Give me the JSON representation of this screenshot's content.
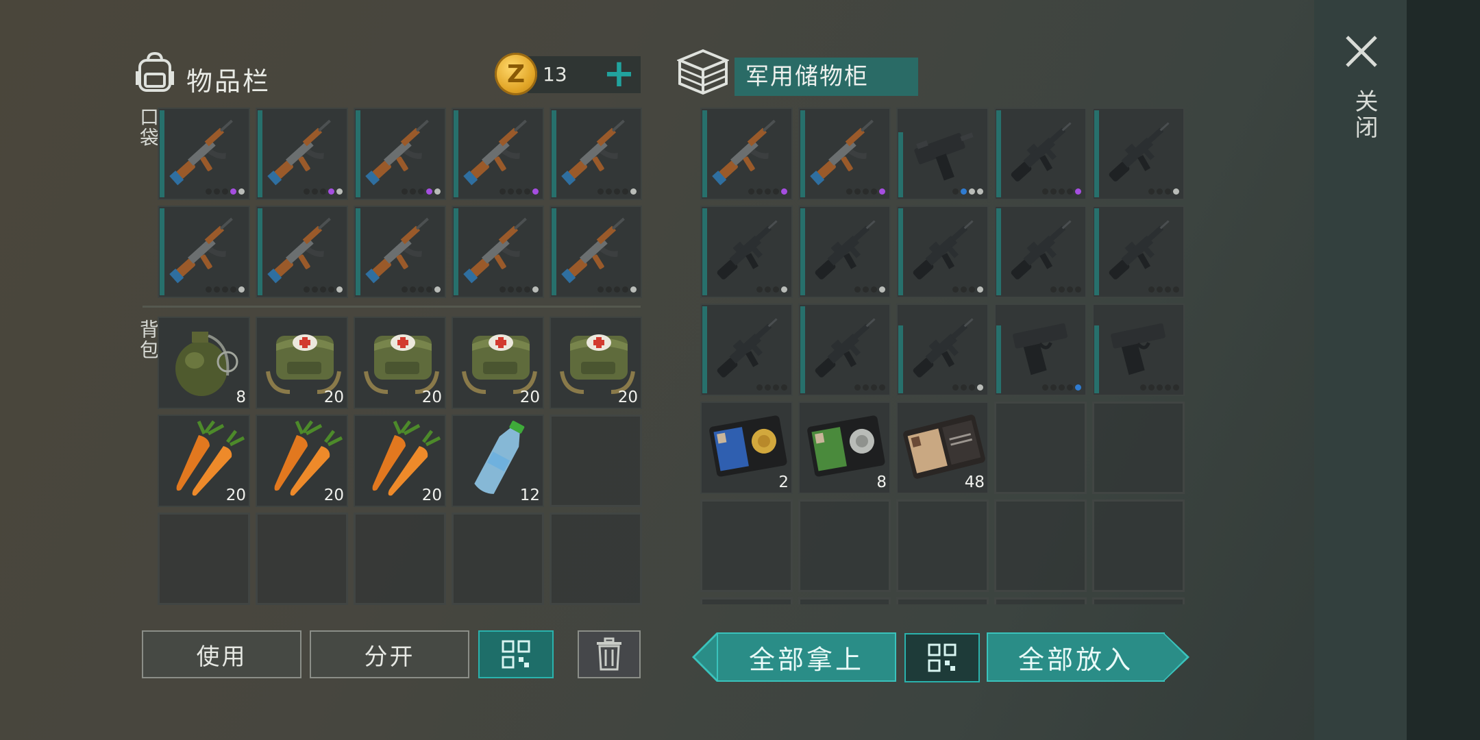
{
  "inventory": {
    "title": "物品栏",
    "coins": "13",
    "pocket_label": "口袋",
    "backpack_label": "背包",
    "pocket": [
      {
        "icon": "ak-rifle-icon",
        "dots": [
          "off",
          "off",
          "off",
          "p",
          "g"
        ]
      },
      {
        "icon": "ak-rifle-icon",
        "dots": [
          "off",
          "off",
          "off",
          "p",
          "g"
        ]
      },
      {
        "icon": "ak-rifle-icon",
        "dots": [
          "off",
          "off",
          "off",
          "p",
          "g"
        ]
      },
      {
        "icon": "ak-rifle-icon",
        "dots": [
          "off",
          "off",
          "off",
          "off",
          "p"
        ]
      },
      {
        "icon": "ak-rifle-icon",
        "dots": [
          "off",
          "off",
          "off",
          "off",
          "g"
        ]
      },
      {
        "icon": "ak-rifle-icon",
        "dots": [
          "off",
          "off",
          "off",
          "off",
          "g"
        ]
      },
      {
        "icon": "ak-rifle-icon",
        "dots": [
          "off",
          "off",
          "off",
          "off",
          "g"
        ]
      },
      {
        "icon": "ak-rifle-icon",
        "dots": [
          "off",
          "off",
          "off",
          "off",
          "g"
        ]
      },
      {
        "icon": "ak-rifle-icon",
        "dots": [
          "off",
          "off",
          "off",
          "off",
          "g"
        ]
      },
      {
        "icon": "ak-rifle-icon",
        "dots": [
          "off",
          "off",
          "off",
          "off",
          "g"
        ]
      }
    ],
    "backpack": [
      {
        "icon": "grenade-icon",
        "count": "8"
      },
      {
        "icon": "medkit-bag-icon",
        "count": "20"
      },
      {
        "icon": "medkit-bag-icon",
        "count": "20"
      },
      {
        "icon": "medkit-bag-icon",
        "count": "20"
      },
      {
        "icon": "medkit-bag-icon",
        "count": "20"
      },
      {
        "icon": "carrot-icon",
        "count": "20"
      },
      {
        "icon": "carrot-icon",
        "count": "20"
      },
      {
        "icon": "carrot-icon",
        "count": "20"
      },
      {
        "icon": "water-bottle-icon",
        "count": "12"
      },
      {
        "icon": "",
        "count": ""
      },
      {
        "icon": "",
        "count": ""
      },
      {
        "icon": "",
        "count": ""
      },
      {
        "icon": "",
        "count": ""
      },
      {
        "icon": "",
        "count": ""
      },
      {
        "icon": "",
        "count": ""
      }
    ],
    "buttons": {
      "use": "使用",
      "split": "分开"
    }
  },
  "container": {
    "title": "军用储物柜",
    "slots": [
      {
        "icon": "ak-rifle-icon",
        "dots": [
          "off",
          "off",
          "off",
          "off",
          "p"
        ]
      },
      {
        "icon": "ak-rifle-icon",
        "dots": [
          "off",
          "off",
          "off",
          "off",
          "p"
        ]
      },
      {
        "icon": "uzi-icon",
        "dots": [
          "off",
          "b",
          "g",
          "g"
        ]
      },
      {
        "icon": "m16-rifle-icon",
        "dots": [
          "off",
          "off",
          "off",
          "off",
          "p"
        ]
      },
      {
        "icon": "m16-rifle-icon",
        "dots": [
          "off",
          "off",
          "off",
          "g"
        ]
      },
      {
        "icon": "m16-rifle-icon",
        "dots": [
          "off",
          "off",
          "off",
          "g"
        ]
      },
      {
        "icon": "m16-rifle-icon",
        "dots": [
          "off",
          "off",
          "off",
          "g"
        ]
      },
      {
        "icon": "m16-rifle-icon",
        "dots": [
          "off",
          "off",
          "off",
          "g"
        ]
      },
      {
        "icon": "m16-rifle-icon",
        "dots": [
          "off",
          "off",
          "off",
          "off"
        ]
      },
      {
        "icon": "m16-rifle-icon",
        "dots": [
          "off",
          "off",
          "off",
          "off"
        ]
      },
      {
        "icon": "m16-rifle-icon",
        "dots": [
          "off",
          "off",
          "off",
          "off"
        ]
      },
      {
        "icon": "m16-rifle-icon",
        "dots": [
          "off",
          "off",
          "off",
          "off"
        ]
      },
      {
        "icon": "m16-rifle-icon",
        "dots": [
          "off",
          "off",
          "off",
          "g"
        ]
      },
      {
        "icon": "pistol-icon",
        "dots": [
          "off",
          "off",
          "off",
          "off",
          "b"
        ]
      },
      {
        "icon": "pistol-icon",
        "dots": [
          "off",
          "off",
          "off",
          "off",
          "off"
        ]
      },
      {
        "icon": "blue-badge-wallet-icon",
        "count": "2"
      },
      {
        "icon": "green-badge-wallet-icon",
        "count": "8"
      },
      {
        "icon": "patrol-officer-wallet-icon",
        "count": "48"
      },
      {
        "icon": "",
        "count": ""
      },
      {
        "icon": "",
        "count": ""
      },
      {
        "icon": "",
        "count": ""
      },
      {
        "icon": "",
        "count": ""
      },
      {
        "icon": "",
        "count": ""
      },
      {
        "icon": "",
        "count": ""
      },
      {
        "icon": "",
        "count": ""
      },
      {
        "icon": "",
        "count": ""
      },
      {
        "icon": "",
        "count": ""
      },
      {
        "icon": "",
        "count": ""
      },
      {
        "icon": "",
        "count": ""
      },
      {
        "icon": "",
        "count": ""
      }
    ],
    "buttons": {
      "take_all": "全部拿上",
      "put_all": "全部放入"
    }
  },
  "close_label": "关闭"
}
